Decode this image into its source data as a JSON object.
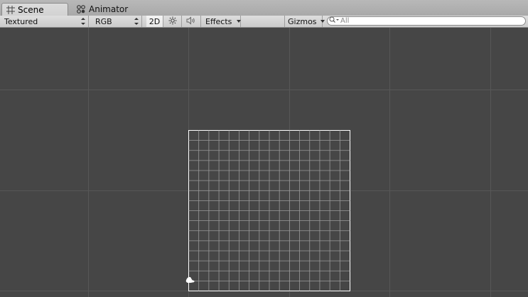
{
  "tabs": [
    {
      "label": "Scene",
      "icon": "grid-icon",
      "active": true
    },
    {
      "label": "Animator",
      "icon": "animator-icon",
      "active": false
    }
  ],
  "toolbar": {
    "draw_mode": "Textured",
    "render_mode": "RGB",
    "mode_2d": "2D",
    "lighting_icon": "sun-icon",
    "audio_icon": "speaker-icon",
    "effects": "Effects",
    "gizmos": "Gizmos",
    "search_placeholder": "All"
  },
  "colors": {
    "scene_background": "#464646",
    "scene_grid": "#575757",
    "object_grid": "#ffffff"
  }
}
